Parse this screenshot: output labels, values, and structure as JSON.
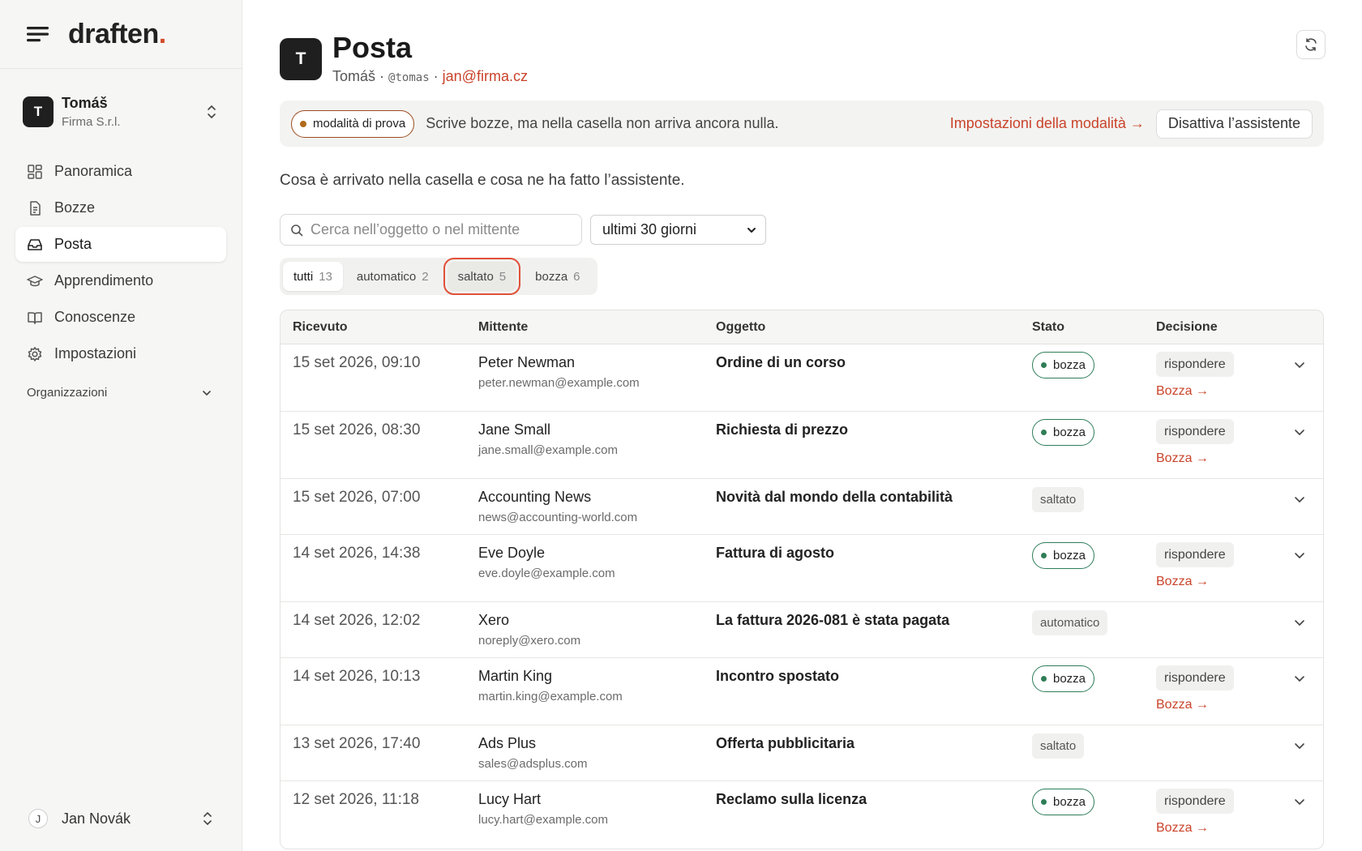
{
  "brand": {
    "name": "draften",
    "dot": "."
  },
  "workspace": {
    "initial": "T",
    "name": "Tomáš",
    "org": "Firma S.r.l."
  },
  "nav": {
    "overview": "Panoramica",
    "drafts": "Bozze",
    "inbox": "Posta",
    "learning": "Apprendimento",
    "knowledge": "Conoscenze",
    "settings": "Impostazioni"
  },
  "organizations_label": "Organizzazioni",
  "user": {
    "initial": "J",
    "name": "Jan Novák"
  },
  "header": {
    "initial": "T",
    "title": "Posta",
    "name": "Tomáš",
    "sep1": "·",
    "handle": "@tomas",
    "sep2": "·",
    "email": "jan@firma.cz"
  },
  "banner": {
    "mode": "modalità di prova",
    "text": "Scrive bozze, ma nella casella non arriva ancora nulla.",
    "link": "Impostazioni della modalità →",
    "button": "Disattiva l’assistente"
  },
  "lead": "Cosa è arrivato nella casella e cosa ne ha fatto l’assistente.",
  "search": {
    "placeholder": "Cerca nell’oggetto o nel mittente"
  },
  "range": {
    "selected": "ultimi 30 giorni"
  },
  "filters": {
    "all": {
      "label": "tutti",
      "count": "13"
    },
    "auto": {
      "label": "automatico",
      "count": "2"
    },
    "skipped": {
      "label": "saltato",
      "count": "5"
    },
    "draft": {
      "label": "bozza",
      "count": "6"
    }
  },
  "table": {
    "headers": {
      "received": "Ricevuto",
      "sender": "Mittente",
      "subject": "Oggetto",
      "state": "Stato",
      "decision": "Decisione"
    },
    "rows": [
      {
        "date": "15 set 2026, 09:10",
        "name": "Peter Newman",
        "email": "peter.newman@example.com",
        "subject": "Ordine di un corso",
        "state": "bozza",
        "decision": "rispondere",
        "link": "Bozza →"
      },
      {
        "date": "15 set 2026, 08:30",
        "name": "Jane Small",
        "email": "jane.small@example.com",
        "subject": "Richiesta di prezzo",
        "state": "bozza",
        "decision": "rispondere",
        "link": "Bozza →"
      },
      {
        "date": "15 set 2026, 07:00",
        "name": "Accounting News",
        "email": "news@accounting-world.com",
        "subject": "Novità dal mondo della contabilità",
        "state": "saltato"
      },
      {
        "date": "14 set 2026, 14:38",
        "name": "Eve Doyle",
        "email": "eve.doyle@example.com",
        "subject": "Fattura di agosto",
        "state": "bozza",
        "decision": "rispondere",
        "link": "Bozza →"
      },
      {
        "date": "14 set 2026, 12:02",
        "name": "Xero",
        "email": "noreply@xero.com",
        "subject": "La fattura 2026-081 è stata pagata",
        "state": "automatico"
      },
      {
        "date": "14 set 2026, 10:13",
        "name": "Martin King",
        "email": "martin.king@example.com",
        "subject": "Incontro spostato",
        "state": "bozza",
        "decision": "rispondere",
        "link": "Bozza →"
      },
      {
        "date": "13 set 2026, 17:40",
        "name": "Ads Plus",
        "email": "sales@adsplus.com",
        "subject": "Offerta pubblicitaria",
        "state": "saltato"
      },
      {
        "date": "12 set 2026, 11:18",
        "name": "Lucy Hart",
        "email": "lucy.hart@example.com",
        "subject": "Reclamo sulla licenza",
        "state": "bozza",
        "decision": "rispondere",
        "link": "Bozza →"
      }
    ]
  },
  "colors": {
    "accent": "#c9432a",
    "draft_green": "#2f7d57",
    "focus_ring": "#e05038"
  },
  "icons": {
    "menu": "menu-icon",
    "expand": "chevron-updown-icon",
    "overview": "grid-icon",
    "drafts": "document-icon",
    "inbox": "inbox-icon",
    "learning": "graduation-cap-icon",
    "knowledge": "book-icon",
    "settings": "gear-icon",
    "refresh": "refresh-icon",
    "search": "search-icon",
    "row_expand": "chevron-down-icon"
  }
}
